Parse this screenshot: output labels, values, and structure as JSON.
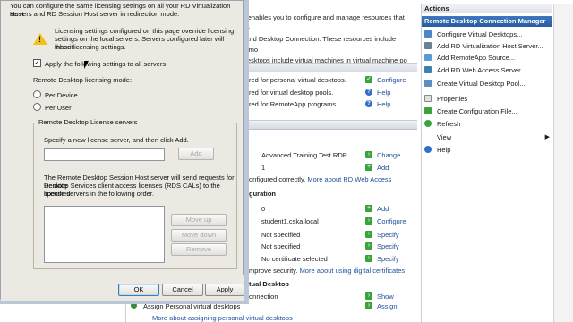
{
  "console": {
    "intro_lines": [
      "er enables you to configure and manage resources that are",
      "p and Desktop Connection. These resources include Remo",
      "l desktops include virtual machines in virtual machine po"
    ],
    "resources_rows": [
      {
        "text": "red for personal virtual desktops.",
        "action": "Configure",
        "icon": "check"
      },
      {
        "text": "red for virtual desktop pools.",
        "action": "Help",
        "icon": "help"
      },
      {
        "text": "red for RemoteApp programs.",
        "action": "Help",
        "icon": "help"
      }
    ],
    "webaccess_rows": [
      {
        "label": "Advanced Training Test RDP",
        "action": "Change"
      },
      {
        "label": "1",
        "action": "Add"
      },
      {
        "label": "onfigured correctly.",
        "link": "More about RD Web Access"
      }
    ],
    "config_header": "guration",
    "config_rows": [
      {
        "label": "0",
        "action": "Add"
      },
      {
        "label": "student1.cska.local",
        "action": "Configure"
      },
      {
        "label": "Not specified",
        "action": "Specify"
      },
      {
        "label": "Not specified",
        "action": "Specify"
      },
      {
        "label": "No certificate selected",
        "action": "Specify"
      }
    ],
    "cert_note": "mprove security.",
    "cert_link": "More about using digital certificates",
    "vdesk_header": "tual Desktop",
    "connection_row": {
      "label": "onnection",
      "action": "Show"
    },
    "assign_row": {
      "label": "Assign Personal virtual desktops",
      "action": "Assign"
    },
    "more_link": "More about assigning personal virtual desktops"
  },
  "dialog": {
    "intro": [
      "You can configure the same licensing settings on all your RD Virtualization Host",
      "servers and RD Session Host server in redirection mode."
    ],
    "warning": [
      "Licensing settings configured on this page override licensing",
      "settings on the local servers. Servers configured later will inherit",
      "these licensing settings."
    ],
    "apply_checkbox_label": "Apply the following settings to all servers",
    "apply_checked": true,
    "licensing_mode_label": "Remote Desktop licensing mode:",
    "per_device": "Per Device",
    "per_user": "Per User",
    "license_servers_group": "Remote Desktop License servers",
    "specify_text": "Specify a new license server, and then click Add.",
    "add_button": "Add",
    "order_text": [
      "The Remote Desktop Session Host server will send requests for Remote",
      "Desktop Services client access licenses (RDS CALs) to the specified",
      "license servers in the following order."
    ],
    "move_up": "Move up",
    "move_down": "Move down",
    "remove": "Remove",
    "ok": "OK",
    "cancel": "Cancel",
    "apply": "Apply"
  },
  "actions": {
    "title": "Actions",
    "group": "Remote Desktop Connection Manager",
    "items": [
      {
        "label": "Configure Virtual Desktops...",
        "icon": "virtual-desktop-icon"
      },
      {
        "label": "Add RD Virtualization Host Server...",
        "icon": "server-icon"
      },
      {
        "label": "Add RemoteApp Source...",
        "icon": "remoteapp-icon"
      },
      {
        "label": "Add RD Web Access Server",
        "icon": "web-server-icon"
      },
      {
        "label": "Create Virtual Desktop Pool...",
        "icon": "pool-icon"
      },
      {
        "label": "Properties",
        "icon": "properties-icon"
      },
      {
        "label": "Create Configuration File...",
        "icon": "config-file-icon"
      },
      {
        "label": "Refresh",
        "icon": "refresh-icon"
      },
      {
        "label": "View",
        "icon": ""
      },
      {
        "label": "Help",
        "icon": "help-icon"
      }
    ]
  },
  "colors": {
    "accent": "#285b9e",
    "link": "#1f4e9a",
    "action_green": "#3aa43a"
  }
}
